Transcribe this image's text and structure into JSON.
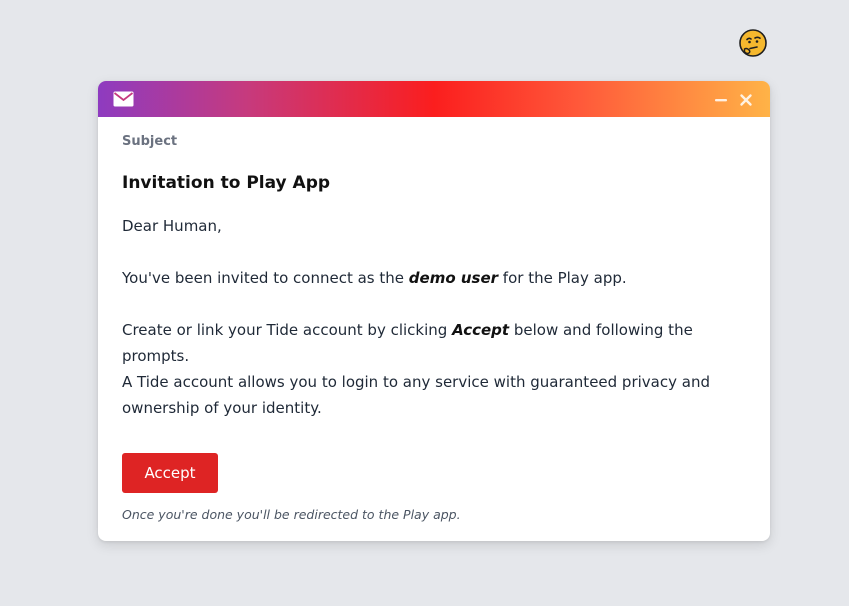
{
  "header": {
    "emoji_icon": "thinking-face-icon",
    "mail_icon": "envelope-icon",
    "minimize_icon": "minimize-icon",
    "close_icon": "close-icon"
  },
  "colors": {
    "background": "#e5e7eb",
    "accept_button": "#de2424",
    "gradient": [
      "#8e3bc0",
      "#fb1e1e",
      "#ffb347"
    ]
  },
  "email": {
    "subject_label": "Subject",
    "subject": "Invitation to Play App",
    "greeting": "Dear Human,",
    "invite": {
      "before": "You've been invited to connect as the ",
      "emphasis": "demo user",
      "after": " for the Play app."
    },
    "create": {
      "before": "Create or link your Tide account by clicking ",
      "emphasis": "Accept",
      "after": " below and following the prompts."
    },
    "tide_info": "A Tide account allows you to login to any service with guaranteed privacy and ownership of your identity.",
    "accept_label": "Accept",
    "footnote": "Once you're done you'll be redirected to the Play app."
  }
}
